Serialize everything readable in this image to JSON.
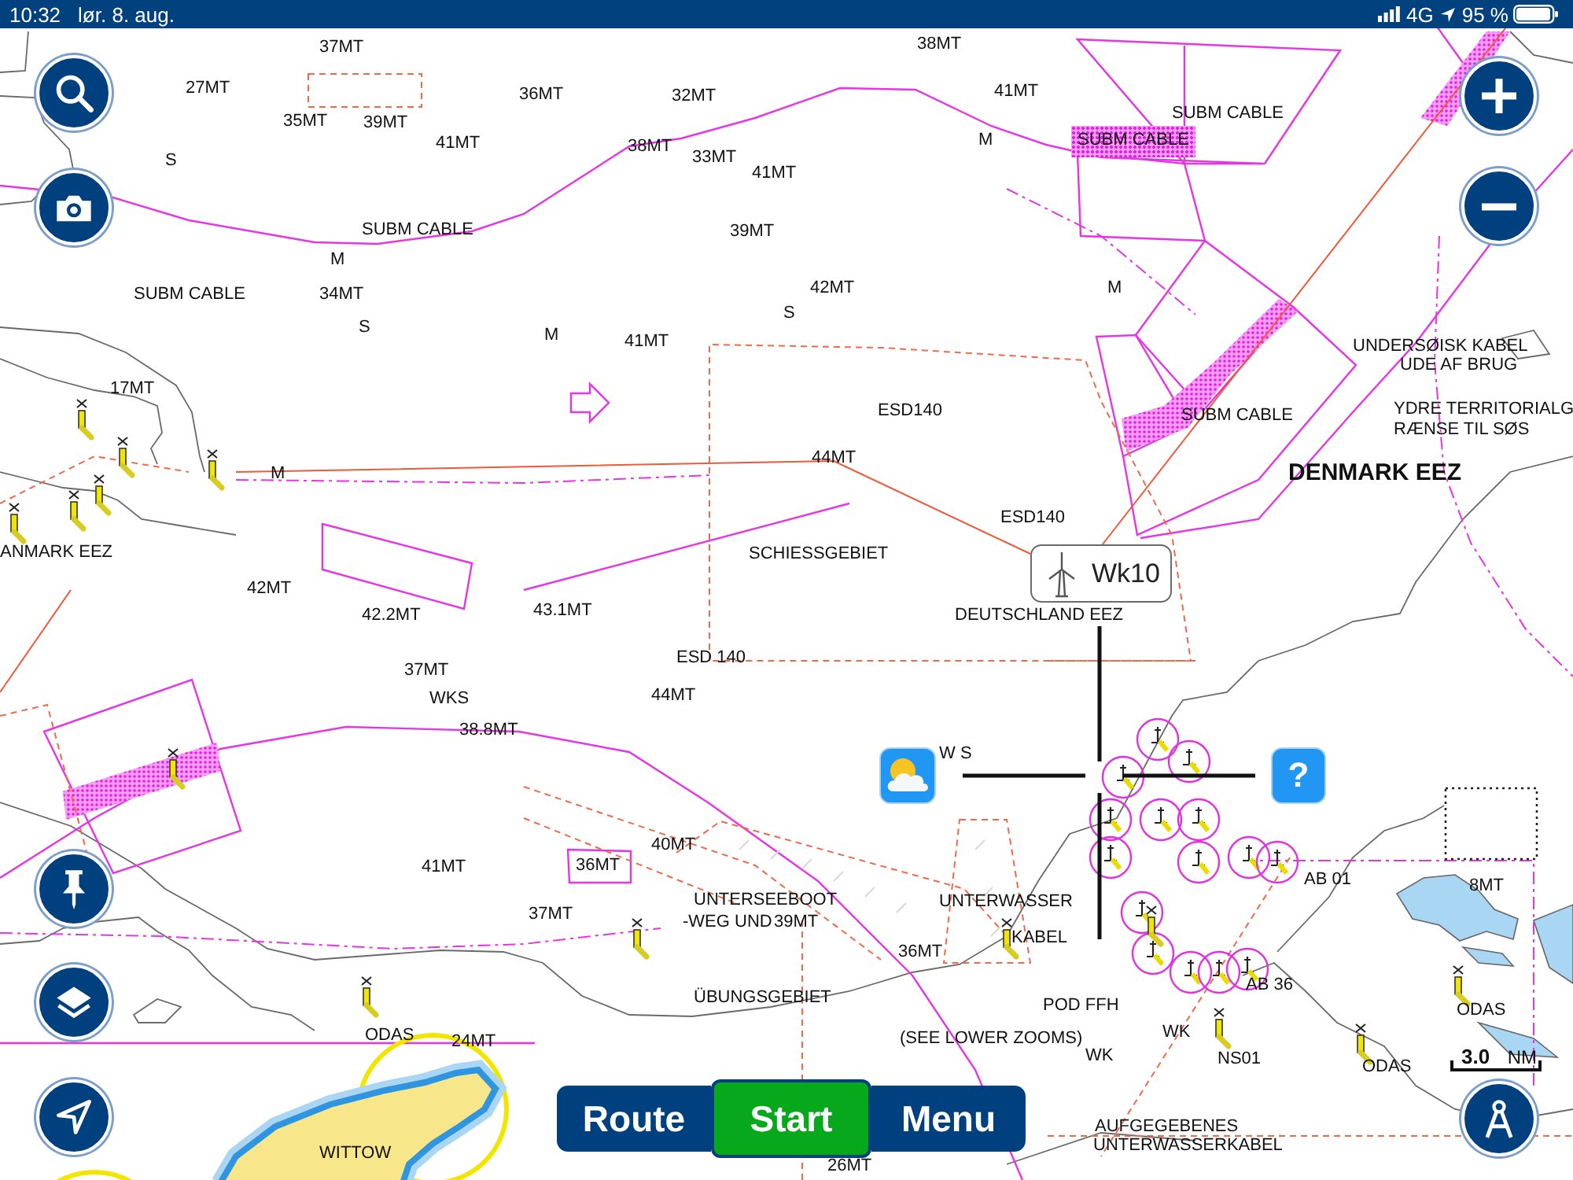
{
  "status_bar": {
    "time": "10:32",
    "date": "lør. 8. aug.",
    "network": "4G",
    "battery": "95 %"
  },
  "chart": {
    "labels": [
      {
        "text": "37MT",
        "kind": "sounding"
      },
      {
        "text": "38MT",
        "kind": "sounding"
      },
      {
        "text": "27MT",
        "kind": "sounding"
      },
      {
        "text": "36MT",
        "kind": "sounding"
      },
      {
        "text": "32MT",
        "kind": "sounding"
      },
      {
        "text": "41MT",
        "kind": "sounding"
      },
      {
        "text": "35MT",
        "kind": "sounding"
      },
      {
        "text": "39MT",
        "kind": "sounding"
      },
      {
        "text": "SUBM CABLE",
        "kind": "note"
      },
      {
        "text": "41MT",
        "kind": "sounding"
      },
      {
        "text": "38MT",
        "kind": "sounding"
      },
      {
        "text": "M",
        "kind": "note"
      },
      {
        "text": "SUBM CABLE",
        "kind": "hatched_note"
      },
      {
        "text": "S",
        "kind": "note"
      },
      {
        "text": "33MT",
        "kind": "sounding"
      },
      {
        "text": "41MT",
        "kind": "sounding"
      },
      {
        "text": "SUBM CABLE",
        "kind": "note"
      },
      {
        "text": "39MT",
        "kind": "sounding"
      },
      {
        "text": "M",
        "kind": "note"
      },
      {
        "text": "SUBM CABLE",
        "kind": "note"
      },
      {
        "text": "34MT",
        "kind": "sounding"
      },
      {
        "text": "42MT",
        "kind": "sounding"
      },
      {
        "text": "M",
        "kind": "note"
      },
      {
        "text": "S",
        "kind": "note"
      },
      {
        "text": "S",
        "kind": "note"
      },
      {
        "text": "M",
        "kind": "note"
      },
      {
        "text": "41MT",
        "kind": "sounding"
      },
      {
        "text": "UNDERSØISK KABEL",
        "kind": "note"
      },
      {
        "text": "UDE AF BRUG",
        "kind": "note"
      },
      {
        "text": "17MT",
        "kind": "sounding"
      },
      {
        "text": "ESD140",
        "kind": "note"
      },
      {
        "text": "SUBM CABLE",
        "kind": "note"
      },
      {
        "text": "YDRE TERRITORIALG",
        "kind": "note"
      },
      {
        "text": "RÆNSE TIL SØS",
        "kind": "note"
      },
      {
        "text": "44MT",
        "kind": "sounding"
      },
      {
        "text": "M",
        "kind": "note"
      },
      {
        "text": "DENMARK EEZ",
        "kind": "region"
      },
      {
        "text": "ESD140",
        "kind": "note"
      },
      {
        "text": "ANMARK EEZ",
        "kind": "note"
      },
      {
        "text": "SCHIESSGEBIET",
        "kind": "note"
      },
      {
        "text": "42MT",
        "kind": "sounding"
      },
      {
        "text": "42.2MT",
        "kind": "sounding"
      },
      {
        "text": "43.1MT",
        "kind": "sounding"
      },
      {
        "text": "DEUTSCHLAND EEZ",
        "kind": "note"
      },
      {
        "text": "ESD 140",
        "kind": "note"
      },
      {
        "text": "37MT",
        "kind": "sounding"
      },
      {
        "text": "WKS",
        "kind": "note"
      },
      {
        "text": "44MT",
        "kind": "sounding"
      },
      {
        "text": "38.8MT",
        "kind": "sounding"
      },
      {
        "text": "W S",
        "kind": "note"
      },
      {
        "text": "40MT",
        "kind": "sounding"
      },
      {
        "text": "41MT",
        "kind": "sounding"
      },
      {
        "text": "36MT",
        "kind": "sounding"
      },
      {
        "text": "AB 01",
        "kind": "note"
      },
      {
        "text": "8MT",
        "kind": "sounding"
      },
      {
        "text": "UNTERSEEBOOT",
        "kind": "note"
      },
      {
        "text": "UNTERWASSER",
        "kind": "note"
      },
      {
        "text": "37MT",
        "kind": "sounding"
      },
      {
        "text": "-WEG UND",
        "kind": "note"
      },
      {
        "text": "39MT",
        "kind": "sounding"
      },
      {
        "text": "KABEL",
        "kind": "note"
      },
      {
        "text": "36MT",
        "kind": "sounding"
      },
      {
        "text": "AB 36",
        "kind": "note"
      },
      {
        "text": "ÜBUNGSGEBIET",
        "kind": "note"
      },
      {
        "text": "POD FFH",
        "kind": "note"
      },
      {
        "text": "ODAS",
        "kind": "note"
      },
      {
        "text": "ODAS",
        "kind": "note"
      },
      {
        "text": "24MT",
        "kind": "sounding"
      },
      {
        "text": "(SEE LOWER ZOOMS)",
        "kind": "note"
      },
      {
        "text": "WK",
        "kind": "note"
      },
      {
        "text": "WK",
        "kind": "note"
      },
      {
        "text": "NS01",
        "kind": "note"
      },
      {
        "text": "ODAS",
        "kind": "note"
      },
      {
        "text": "AUFGEGEBENES",
        "kind": "note"
      },
      {
        "text": "WITTOW",
        "kind": "note"
      },
      {
        "text": "UNTERWASSERKABEL",
        "kind": "note"
      },
      {
        "text": "26MT",
        "kind": "sounding"
      }
    ],
    "callout": {
      "title": "Wk10"
    },
    "scale": {
      "value": "3.0",
      "unit": "NM"
    }
  },
  "help_button": {
    "label": "?"
  },
  "bottom_bar": [
    {
      "label": "Route",
      "kind": "nav"
    },
    {
      "label": "Start",
      "kind": "primary"
    },
    {
      "label": "Menu",
      "kind": "nav"
    }
  ]
}
